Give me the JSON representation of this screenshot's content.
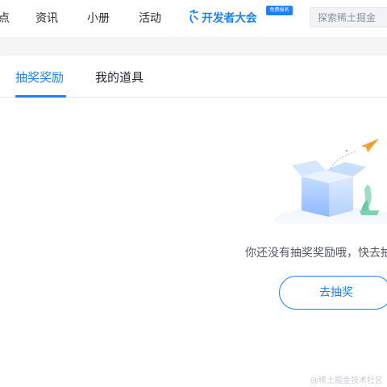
{
  "nav": {
    "items": [
      {
        "label": "点"
      },
      {
        "label": "资讯"
      },
      {
        "label": "小册"
      },
      {
        "label": "活动"
      }
    ],
    "brand": {
      "label": "开发者大会",
      "badge": "免费报名"
    },
    "search": {
      "placeholder": "探索稀土掘金"
    }
  },
  "tabs": [
    {
      "label": "抽奖奖励",
      "active": true
    },
    {
      "label": "我的道具",
      "active": false
    }
  ],
  "empty_state": {
    "message": "你还没有抽奖奖励哦，快去抽",
    "cta_label": "去抽奖"
  },
  "watermark": "@稀土掘金技术社区",
  "colors": {
    "accent": "#1e80ff",
    "text": "#252933",
    "muted": "#515767",
    "page_bg": "#f4f5f5"
  }
}
